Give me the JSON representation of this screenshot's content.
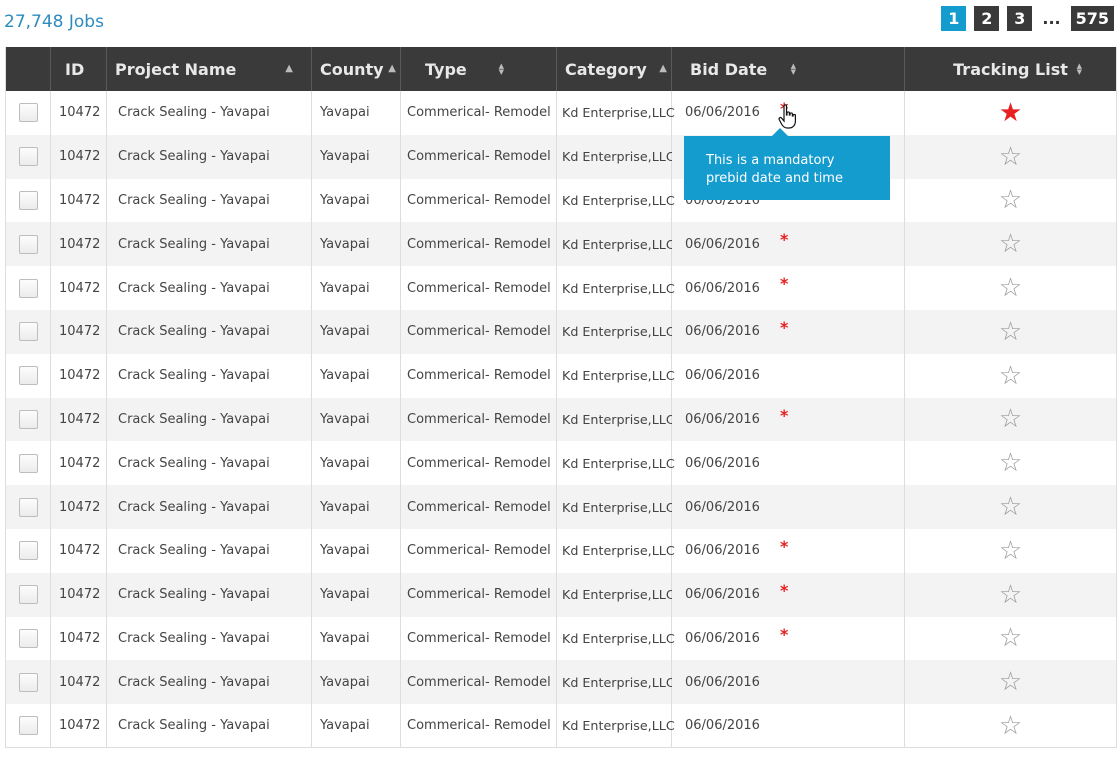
{
  "jobs_count": "27,748 Jobs",
  "pagination": {
    "pages": [
      "1",
      "2",
      "3"
    ],
    "ellipsis": "...",
    "last": "575",
    "active": "1"
  },
  "table": {
    "columns": [
      "",
      "ID",
      "Project Name",
      "County",
      "Type",
      "Category",
      "Bid Date",
      "Tracking List"
    ],
    "rows": [
      {
        "id": "10472",
        "project": "Crack Sealing - Yavapai",
        "county": "Yavapai",
        "type": "Commerical- Remodel",
        "category": "Kd Enterprise,LLC",
        "bid_date": "06/06/2016",
        "mandatory": "*",
        "tracked": true
      },
      {
        "id": "10472",
        "project": "Crack Sealing - Yavapai",
        "county": "Yavapai",
        "type": "Commerical- Remodel",
        "category": "Kd Enterprise,LLC",
        "bid_date": "06/06/2016",
        "mandatory": "",
        "tracked": false
      },
      {
        "id": "10472",
        "project": "Crack Sealing - Yavapai",
        "county": "Yavapai",
        "type": "Commerical- Remodel",
        "category": "Kd Enterprise,LLC",
        "bid_date": "06/06/2016",
        "mandatory": "*",
        "tracked": false
      },
      {
        "id": "10472",
        "project": "Crack Sealing - Yavapai",
        "county": "Yavapai",
        "type": "Commerical- Remodel",
        "category": "Kd Enterprise,LLC",
        "bid_date": "06/06/2016",
        "mandatory": "*",
        "tracked": false
      },
      {
        "id": "10472",
        "project": "Crack Sealing - Yavapai",
        "county": "Yavapai",
        "type": "Commerical- Remodel",
        "category": "Kd Enterprise,LLC",
        "bid_date": "06/06/2016",
        "mandatory": "*",
        "tracked": false
      },
      {
        "id": "10472",
        "project": "Crack Sealing - Yavapai",
        "county": "Yavapai",
        "type": "Commerical- Remodel",
        "category": "Kd Enterprise,LLC",
        "bid_date": "06/06/2016",
        "mandatory": "*",
        "tracked": false
      },
      {
        "id": "10472",
        "project": "Crack Sealing - Yavapai",
        "county": "Yavapai",
        "type": "Commerical- Remodel",
        "category": "Kd Enterprise,LLC",
        "bid_date": "06/06/2016",
        "mandatory": "",
        "tracked": false
      },
      {
        "id": "10472",
        "project": "Crack Sealing - Yavapai",
        "county": "Yavapai",
        "type": "Commerical- Remodel",
        "category": "Kd Enterprise,LLC",
        "bid_date": "06/06/2016",
        "mandatory": "*",
        "tracked": false
      },
      {
        "id": "10472",
        "project": "Crack Sealing - Yavapai",
        "county": "Yavapai",
        "type": "Commerical- Remodel",
        "category": "Kd Enterprise,LLC",
        "bid_date": "06/06/2016",
        "mandatory": "",
        "tracked": false
      },
      {
        "id": "10472",
        "project": "Crack Sealing - Yavapai",
        "county": "Yavapai",
        "type": "Commerical- Remodel",
        "category": "Kd Enterprise,LLC",
        "bid_date": "06/06/2016",
        "mandatory": "",
        "tracked": false
      },
      {
        "id": "10472",
        "project": "Crack Sealing - Yavapai",
        "county": "Yavapai",
        "type": "Commerical- Remodel",
        "category": "Kd Enterprise,LLC",
        "bid_date": "06/06/2016",
        "mandatory": "*",
        "tracked": false
      },
      {
        "id": "10472",
        "project": "Crack Sealing - Yavapai",
        "county": "Yavapai",
        "type": "Commerical- Remodel",
        "category": "Kd Enterprise,LLC",
        "bid_date": "06/06/2016",
        "mandatory": "*",
        "tracked": false
      },
      {
        "id": "10472",
        "project": "Crack Sealing - Yavapai",
        "county": "Yavapai",
        "type": "Commerical- Remodel",
        "category": "Kd Enterprise,LLC",
        "bid_date": "06/06/2016",
        "mandatory": "*",
        "tracked": false
      },
      {
        "id": "10472",
        "project": "Crack Sealing - Yavapai",
        "county": "Yavapai",
        "type": "Commerical- Remodel",
        "category": "Kd Enterprise,LLC",
        "bid_date": "06/06/2016",
        "mandatory": "",
        "tracked": false
      },
      {
        "id": "10472",
        "project": "Crack Sealing - Yavapai",
        "county": "Yavapai",
        "type": "Commerical- Remodel",
        "category": "Kd Enterprise,LLC",
        "bid_date": "06/06/2016",
        "mandatory": "",
        "tracked": false
      }
    ]
  },
  "tooltip": {
    "text": "This is a mandatory prebid date and time"
  },
  "colors": {
    "accent": "#159ccf",
    "header_bg": "#3a3a3a",
    "required": "#e82020",
    "link": "#2e8bbf"
  },
  "icons": {
    "tracked": "star-filled-icon",
    "untracked": "star-outline-icon",
    "sort": "sort-arrows-icon",
    "cursor": "hand-pointer-icon"
  }
}
